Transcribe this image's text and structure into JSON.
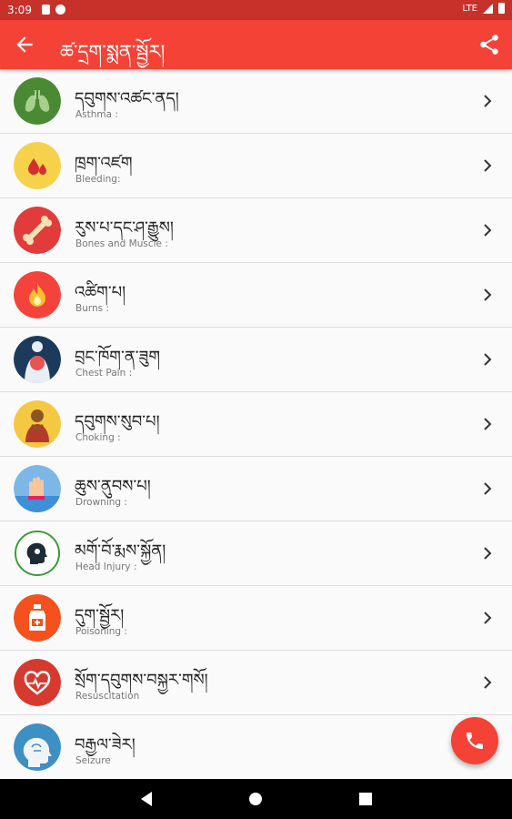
{
  "status_bar": {
    "time": "3:09",
    "network": "LTE"
  },
  "app_bar": {
    "title": "ཚ་དྲག་སྨན་སྦྱོར།"
  },
  "items": [
    {
      "tibetan": "དབུགས་འཚང་ནད།",
      "label": "Asthma :",
      "icon": "lungs-icon"
    },
    {
      "tibetan": "ཁྲག་འཛག",
      "label": "Bleeding:",
      "icon": "blood-drop-icon"
    },
    {
      "tibetan": "རུས་པ་དང་ཤ་རྒྱུས།",
      "label": "Bones and Muscle :",
      "icon": "bone-icon"
    },
    {
      "tibetan": "འཚིག་པ།",
      "label": "Burns :",
      "icon": "fire-icon"
    },
    {
      "tibetan": "བྲང་ཁོག་ན་ཟུག",
      "label": "Chest Pain :",
      "icon": "chest-icon"
    },
    {
      "tibetan": "དབུགས་སུབ་པ།",
      "label": "Choking :",
      "icon": "choking-person-icon"
    },
    {
      "tibetan": "ཆུས་ནུབས་པ།",
      "label": "Drowning :",
      "icon": "drowning-hand-icon"
    },
    {
      "tibetan": "མགོ་བོ་རྨས་སྐྱོན།",
      "label": "Head Injury :",
      "icon": "head-icon"
    },
    {
      "tibetan": "དུག་སྦྱོར།",
      "label": "Poisoning :",
      "icon": "poison-bottle-icon"
    },
    {
      "tibetan": "སྲོག་དབུགས་བསྐྱར་གསོ།",
      "label": "Resuscitation",
      "icon": "heart-pulse-icon"
    },
    {
      "tibetan": "བརྒྱལ་ཟེར།",
      "label": "Seizure",
      "icon": "brain-head-icon"
    }
  ],
  "colors": {
    "status_bar": "#c8302a",
    "app_bar": "#f44336",
    "fab": "#f44336"
  }
}
